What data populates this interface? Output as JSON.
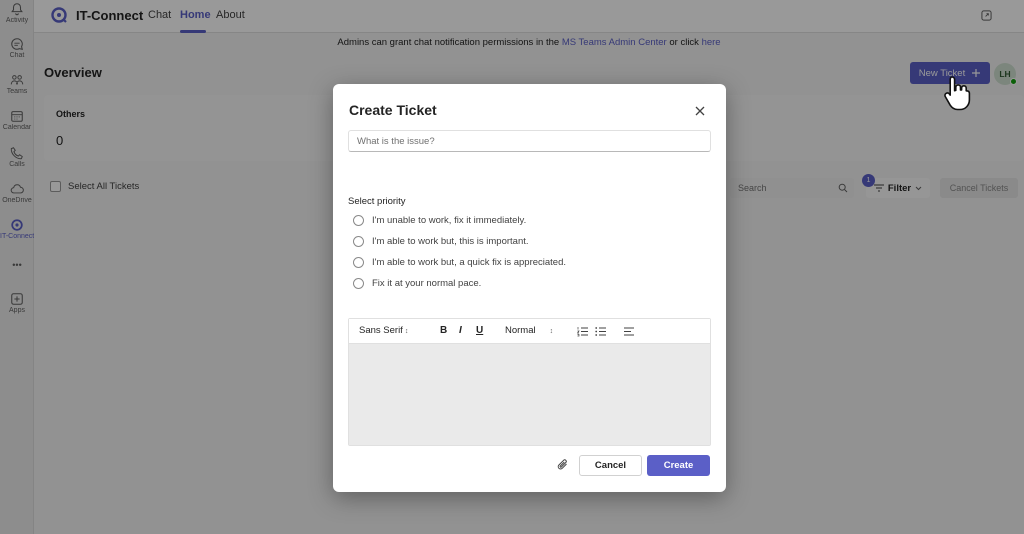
{
  "rail": {
    "items": [
      {
        "label": "Activity",
        "icon": "bell-icon"
      },
      {
        "label": "Chat",
        "icon": "chat-icon"
      },
      {
        "label": "Teams",
        "icon": "teams-icon"
      },
      {
        "label": "Calendar",
        "icon": "calendar-icon"
      },
      {
        "label": "Calls",
        "icon": "phone-icon"
      },
      {
        "label": "OneDrive",
        "icon": "cloud-icon"
      },
      {
        "label": "IT-Connect",
        "icon": "it-connect-icon"
      },
      {
        "label": "Apps",
        "icon": "apps-icon"
      }
    ],
    "more_label": "•••"
  },
  "appbar": {
    "title": "IT-Connect",
    "tabs": [
      {
        "label": "Chat"
      },
      {
        "label": "Home"
      },
      {
        "label": "About"
      }
    ],
    "active_tab": "Home"
  },
  "page": {
    "banner_text": "Admins can grant chat notification permissions in the ",
    "banner_link": "MS Teams Admin Center",
    "banner_middle": " or click ",
    "banner_link2": "here",
    "overview_title": "Overview",
    "card_title": "Others",
    "card_count": "0",
    "select_all_label": "Select All Tickets",
    "search_placeholder": "Search",
    "filter_label": "Filter",
    "filter_badge": "1",
    "cancel_tickets_label": "Cancel Tickets",
    "new_ticket_label": "New Ticket",
    "avatar_initials": "LH"
  },
  "modal": {
    "title": "Create Ticket",
    "issue_placeholder": "What is the issue?",
    "priority_label": "Select priority",
    "priorities": [
      "I'm unable to work, fix it immediately.",
      "I'm able to work but, this is important.",
      "I'm able to work but, a quick fix is appreciated.",
      "Fix it at your normal pace."
    ],
    "toolbar": {
      "font": "Sans Serif",
      "size": "Normal"
    },
    "cancel_label": "Cancel",
    "create_label": "Create"
  },
  "colors": {
    "accent": "#5b5fc7",
    "presence": "#13a10e"
  }
}
